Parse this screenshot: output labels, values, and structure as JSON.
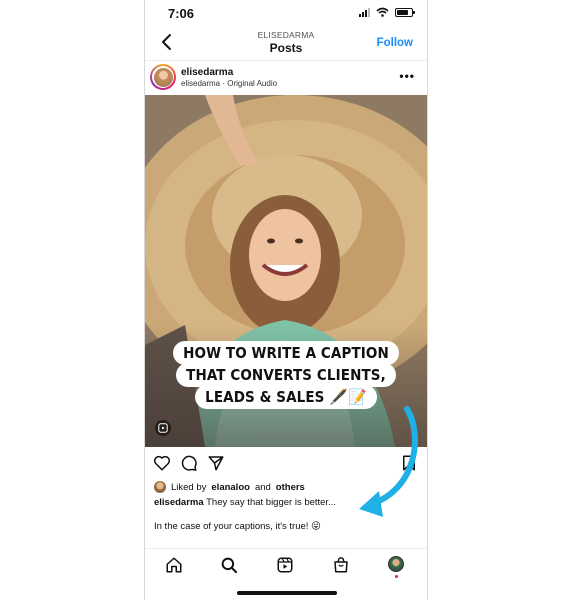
{
  "status_bar": {
    "time": "7:06",
    "battery_level": 0.75
  },
  "header": {
    "account": "ELISEDARMA",
    "title": "Posts",
    "follow_label": "Follow"
  },
  "post": {
    "username": "elisedarma",
    "subline": "elisedarma · Original Audio",
    "more_label": "•••",
    "overlay_lines": [
      "HOW TO WRITE A CAPTION",
      "THAT CONVERTS CLIENTS,",
      "LEADS & SALES 🖋️📝"
    ],
    "liked_by_prefix": "Liked by",
    "liked_by_user": "elanaloo",
    "liked_by_and": "and",
    "liked_by_others": "others",
    "caption_user": "elisedarma",
    "caption_text": "They say that bigger is better...",
    "caption_more": "In the case of your captions, it's true! 😜"
  },
  "icons": [
    "back-chevron-icon",
    "like-heart-icon",
    "comment-icon",
    "share-icon",
    "save-icon",
    "reel-icon",
    "home-icon",
    "search-icon",
    "reels-tab-icon",
    "shop-icon"
  ],
  "colors": {
    "accent": "#1a8cff",
    "annotation_arrow": "#1fb1e6",
    "notification": "#e0245e"
  }
}
